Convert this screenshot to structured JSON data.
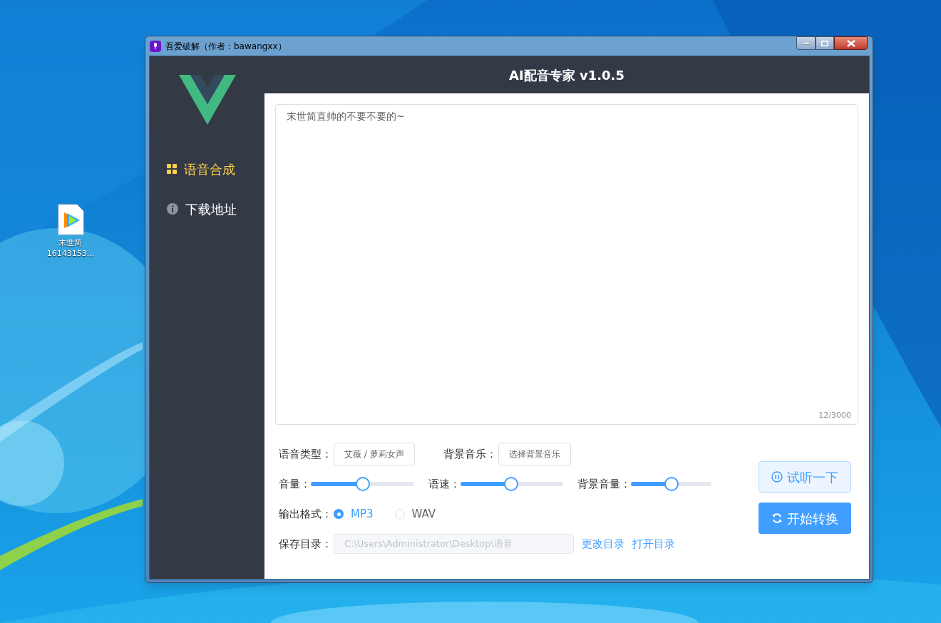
{
  "desktop_icons": [
    {
      "label": "末世简\n16143153..."
    }
  ],
  "window": {
    "title": "吾爱破解（作者：bawangxx）"
  },
  "header": {
    "title": "AI配音专家 v1.0.5"
  },
  "sidebar": {
    "items": [
      {
        "label": "语音合成",
        "kind": "grid",
        "selected": true
      },
      {
        "label": "下载地址",
        "kind": "info",
        "selected": false
      }
    ]
  },
  "text_area": {
    "value": "末世简直帅的不要不要的~",
    "counter": "12/3000"
  },
  "voice_type": {
    "label": "语音类型：",
    "button": "艾薇 / 萝莉女声"
  },
  "background_music": {
    "label": "背景音乐：",
    "button": "选择背景音乐"
  },
  "sliders": [
    {
      "label": "音量：",
      "level": 0.5
    },
    {
      "label": "语速：",
      "level": 0.49
    },
    {
      "label": "背景音量：",
      "level": 0.5
    }
  ],
  "output_format": {
    "label": "输出格式：",
    "options": [
      {
        "label": "MP3",
        "selected": true
      },
      {
        "label": "WAV",
        "selected": false
      }
    ]
  },
  "save_dir": {
    "label": "保存目录：",
    "value": "C:\\Users\\Administrator\\Desktop\\语音",
    "links": [
      "更改目录",
      "打开目录"
    ]
  },
  "buttons": [
    {
      "label": "试听一下",
      "kind": "preview"
    },
    {
      "label": "开始转换",
      "kind": "convert"
    }
  ]
}
